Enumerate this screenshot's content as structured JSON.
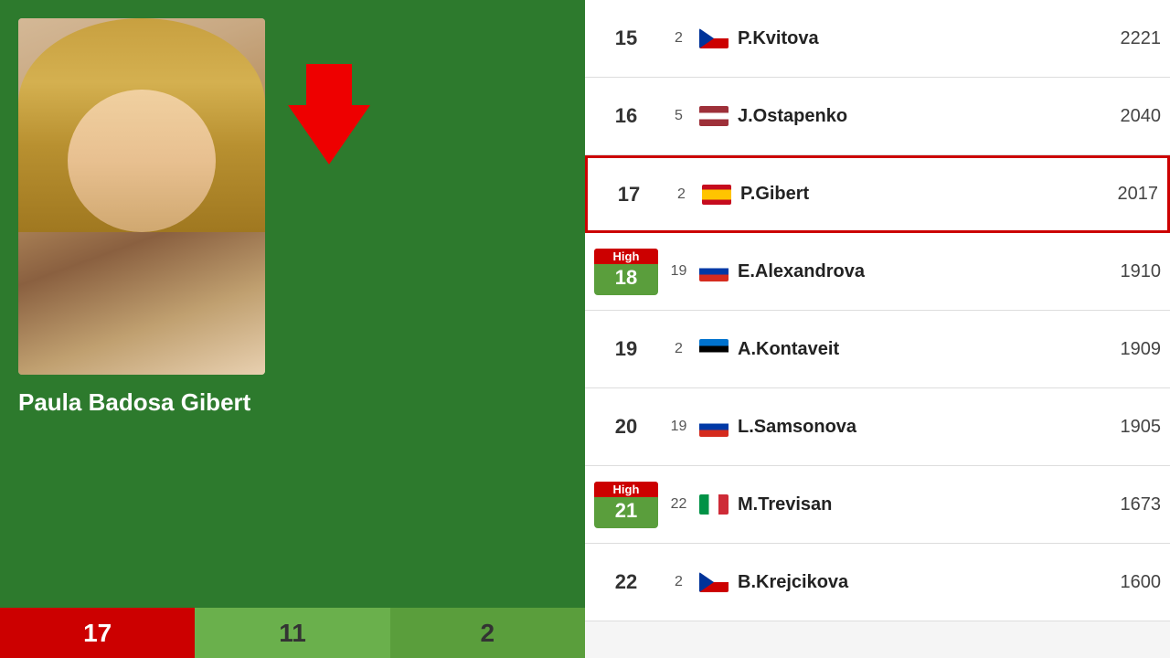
{
  "player": {
    "name": "Paula Badosa Gibert",
    "photo_alt": "Paula Badosa Gibert photo",
    "current_rank": "17",
    "stat1": "11",
    "stat2": "2"
  },
  "rankings": [
    {
      "rank": "15",
      "change": "2",
      "flag_class": "flag-cz",
      "flag_label": "Czech Republic",
      "player_name": "P.Kvitova",
      "points": "2221",
      "highlighted": false,
      "high_badge": false
    },
    {
      "rank": "16",
      "change": "5",
      "flag_class": "flag-lv",
      "flag_label": "Latvia",
      "player_name": "J.Ostapenko",
      "points": "2040",
      "highlighted": false,
      "high_badge": false
    },
    {
      "rank": "17",
      "change": "2",
      "flag_class": "flag-es",
      "flag_label": "Spain",
      "player_name": "P.Gibert",
      "points": "2017",
      "highlighted": true,
      "high_badge": false
    },
    {
      "rank": "18",
      "change": "19",
      "flag_class": "flag-ru",
      "flag_label": "Russia",
      "player_name": "E.Alexandrova",
      "points": "1910",
      "highlighted": false,
      "high_badge": true,
      "high_label": "High",
      "high_number": "18"
    },
    {
      "rank": "19",
      "change": "2",
      "flag_class": "flag-ee",
      "flag_label": "Estonia",
      "player_name": "A.Kontaveit",
      "points": "1909",
      "highlighted": false,
      "high_badge": false
    },
    {
      "rank": "20",
      "change": "19",
      "flag_class": "flag-ru",
      "flag_label": "Russia",
      "player_name": "L.Samsonova",
      "points": "1905",
      "highlighted": false,
      "high_badge": false
    },
    {
      "rank": "21",
      "change": "22",
      "flag_class": "flag-it",
      "flag_label": "Italy",
      "player_name": "M.Trevisan",
      "points": "1673",
      "highlighted": false,
      "high_badge": true,
      "high_label": "High",
      "high_number": "21"
    },
    {
      "rank": "22",
      "change": "2",
      "flag_class": "flag-cz2",
      "flag_label": "Czech Republic",
      "player_name": "B.Krejcikova",
      "points": "1600",
      "highlighted": false,
      "high_badge": false
    }
  ],
  "bottom_bar": {
    "cell1": "17",
    "cell2": "11",
    "cell3": "2"
  }
}
